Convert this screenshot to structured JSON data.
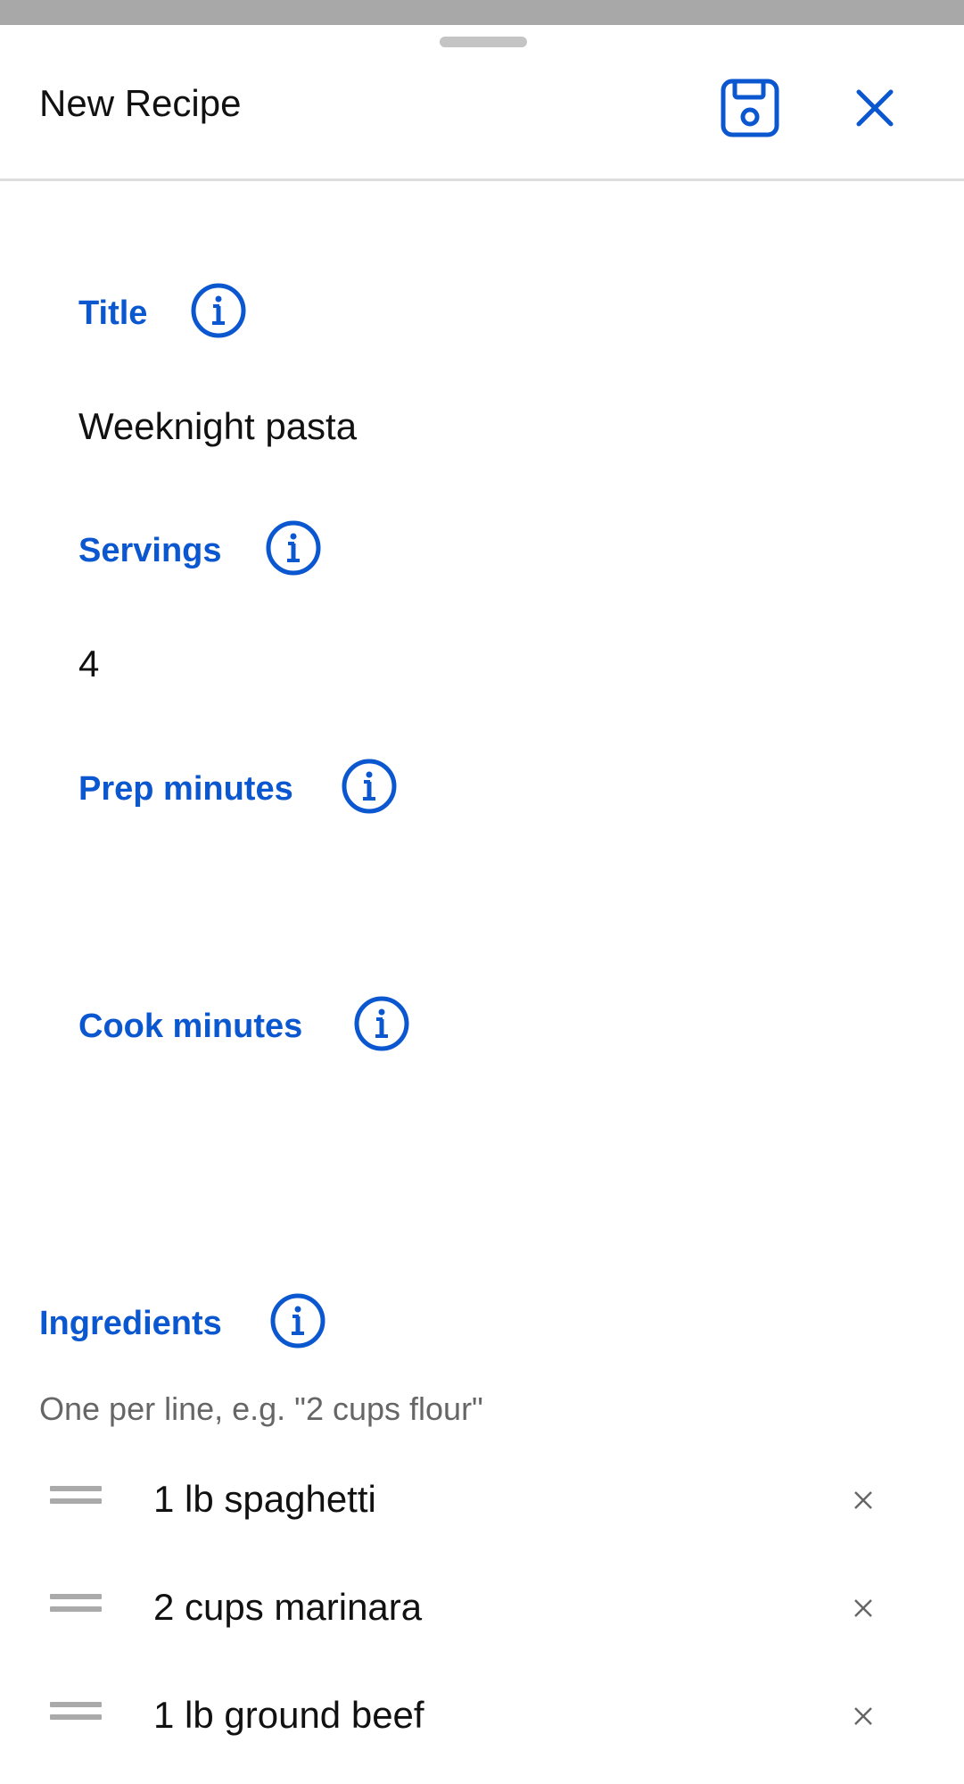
{
  "header": {
    "title": "New Recipe",
    "save_icon": "save-icon",
    "close_icon": "close-icon"
  },
  "form": {
    "title": {
      "label": "Title",
      "value": "Weeknight pasta"
    },
    "servings": {
      "label": "Servings",
      "value": "4"
    },
    "prep_minutes": {
      "label": "Prep minutes",
      "value": ""
    },
    "cook_minutes": {
      "label": "Cook minutes",
      "value": ""
    }
  },
  "ingredients": {
    "label": "Ingredients",
    "hint": "One per line, e.g. \"2 cups flour\"",
    "items": [
      {
        "text": "1 lb spaghetti"
      },
      {
        "text": "2 cups marinara"
      },
      {
        "text": "1 lb ground beef"
      }
    ]
  },
  "colors": {
    "accent": "#0b57d0",
    "text": "#111111",
    "hint": "#666666",
    "divider": "#dedede",
    "top_strip": "#a8a8a8"
  }
}
